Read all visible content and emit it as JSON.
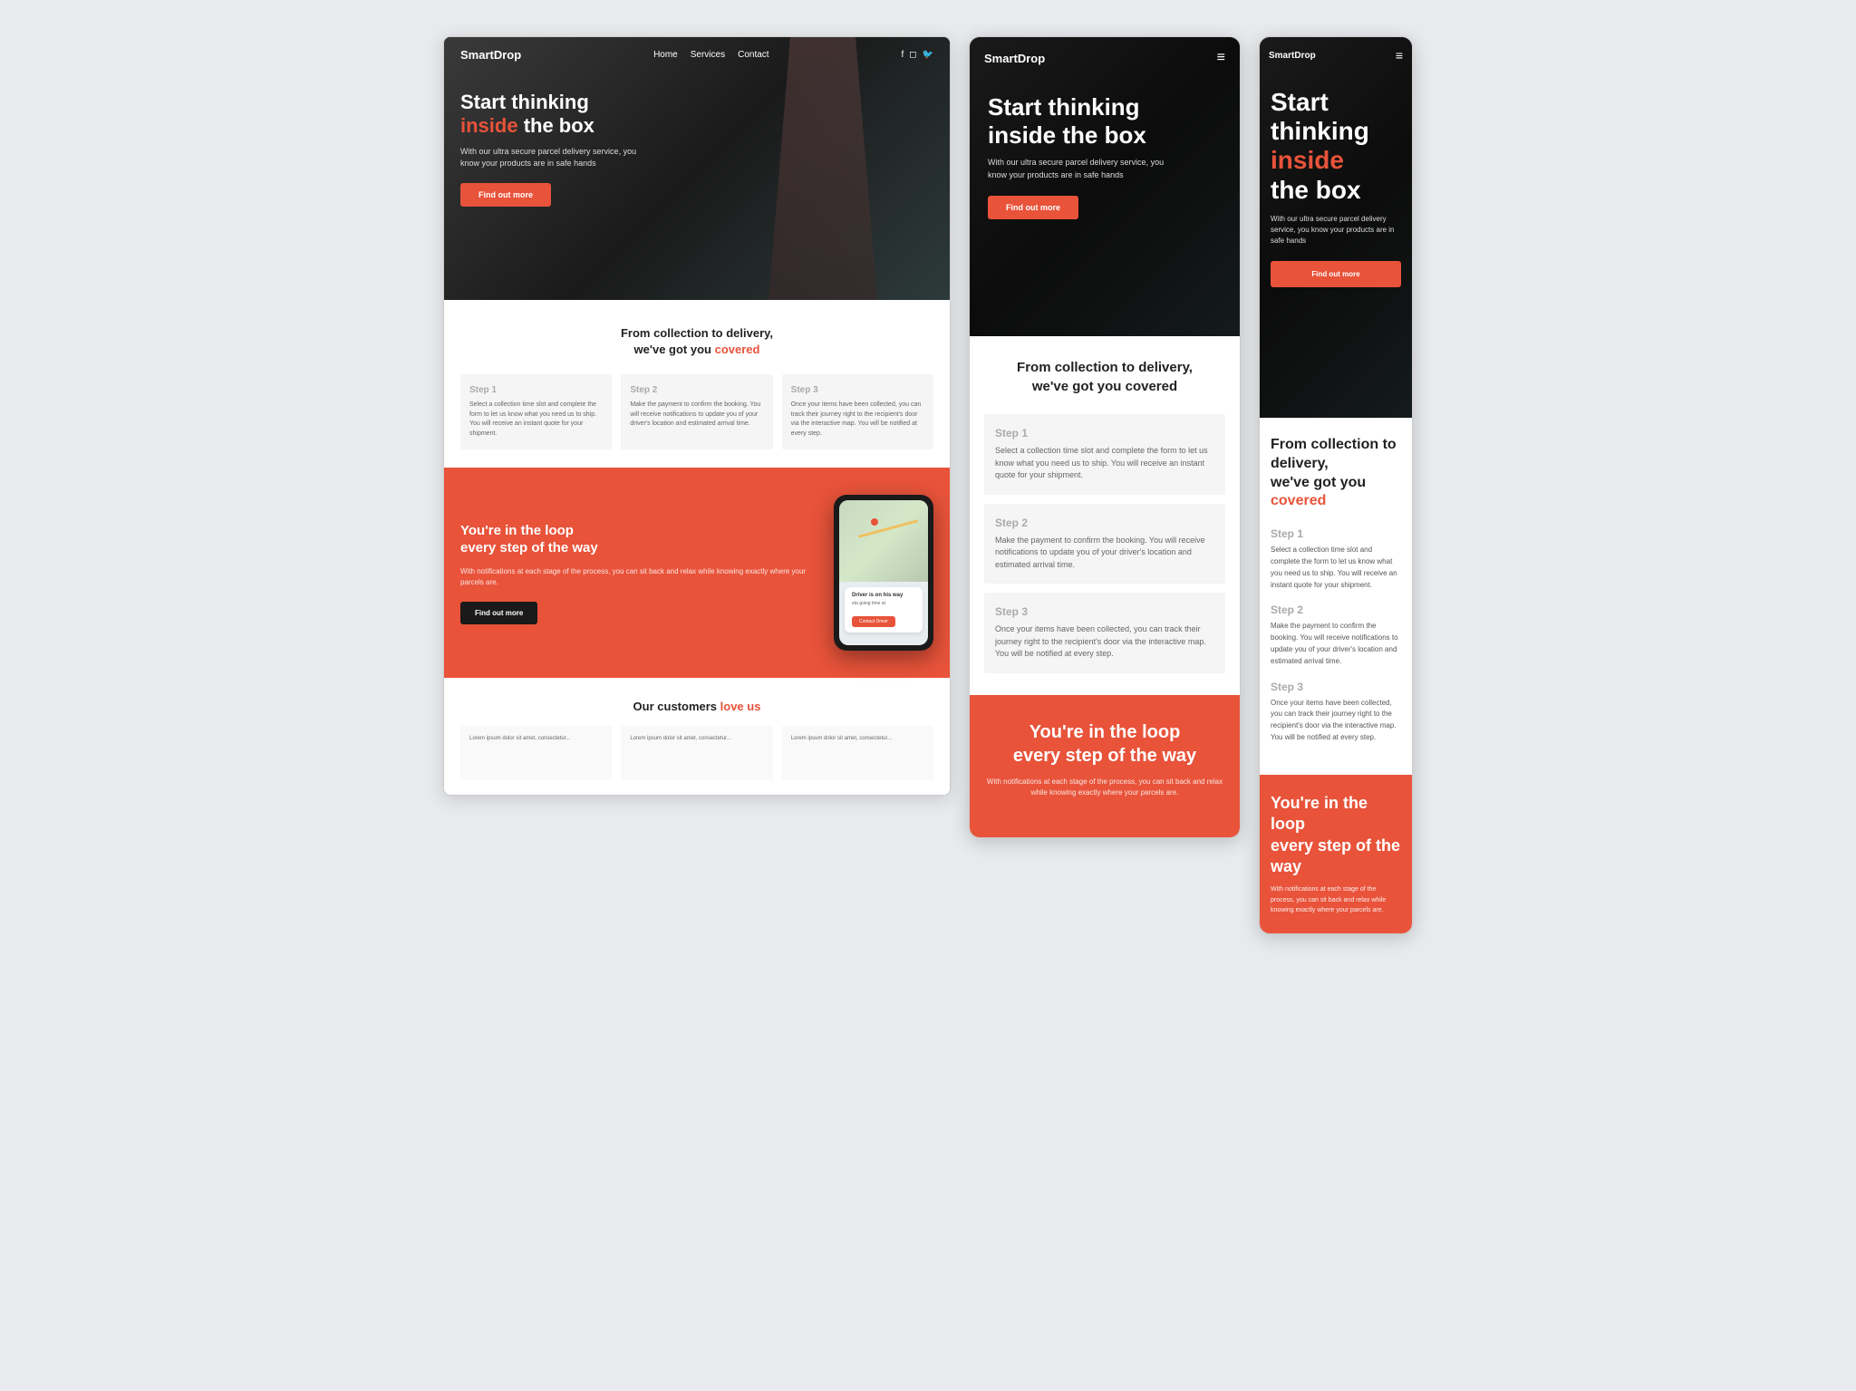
{
  "brand": {
    "name": "SmartDrop",
    "accent_color": "#e8533a"
  },
  "nav": {
    "links": [
      "Home",
      "Services",
      "Contact"
    ],
    "icons": [
      "f",
      "ig",
      "tw"
    ],
    "hamburger": "≡"
  },
  "hero": {
    "line1": "Start thinking",
    "line2_accent": "inside",
    "line2_rest": " the box",
    "subtitle": "With our ultra secure parcel delivery service, you know your products are in safe hands",
    "cta": "Find out more"
  },
  "steps_section": {
    "title_line1": "From collection to delivery,",
    "title_line2_plain": "we've got you ",
    "title_line2_accent": "covered",
    "steps": [
      {
        "title": "Step 1",
        "text": "Select a collection time slot and complete the form to let us know what you need us to ship. You will receive an instant quote for your shipment."
      },
      {
        "title": "Step 2",
        "text": "Make the payment to confirm the booking. You will receive notifications to update you of your driver's location and estimated arrival time."
      },
      {
        "title": "Step 3",
        "text": "Once your items have been collected, you can track their journey right to the recipient's door via the interactive map. You will be notified at every step."
      }
    ]
  },
  "loop_section": {
    "title_line1": "You're in the loop",
    "title_line2": "every step of the way",
    "subtitle": "With notifications at each stage of the process, you can sit back and relax while knowing exactly where your parcels are.",
    "cta": "Find out more",
    "phone_notif_title": "Driver is on his way",
    "phone_notif_text": "eta going time at",
    "phone_notif_btn": "Contact Driver"
  },
  "customers_section": {
    "title_plain": "Our customers ",
    "title_accent": "love us",
    "reviews": [
      {
        "text": "Lorem ipsum dolor sit amet, consectetur..."
      },
      {
        "text": "Lorem ipsum dolor sit amet, consectetur..."
      },
      {
        "text": "Lorem ipsum dolor sit amet, consectetur..."
      }
    ]
  }
}
